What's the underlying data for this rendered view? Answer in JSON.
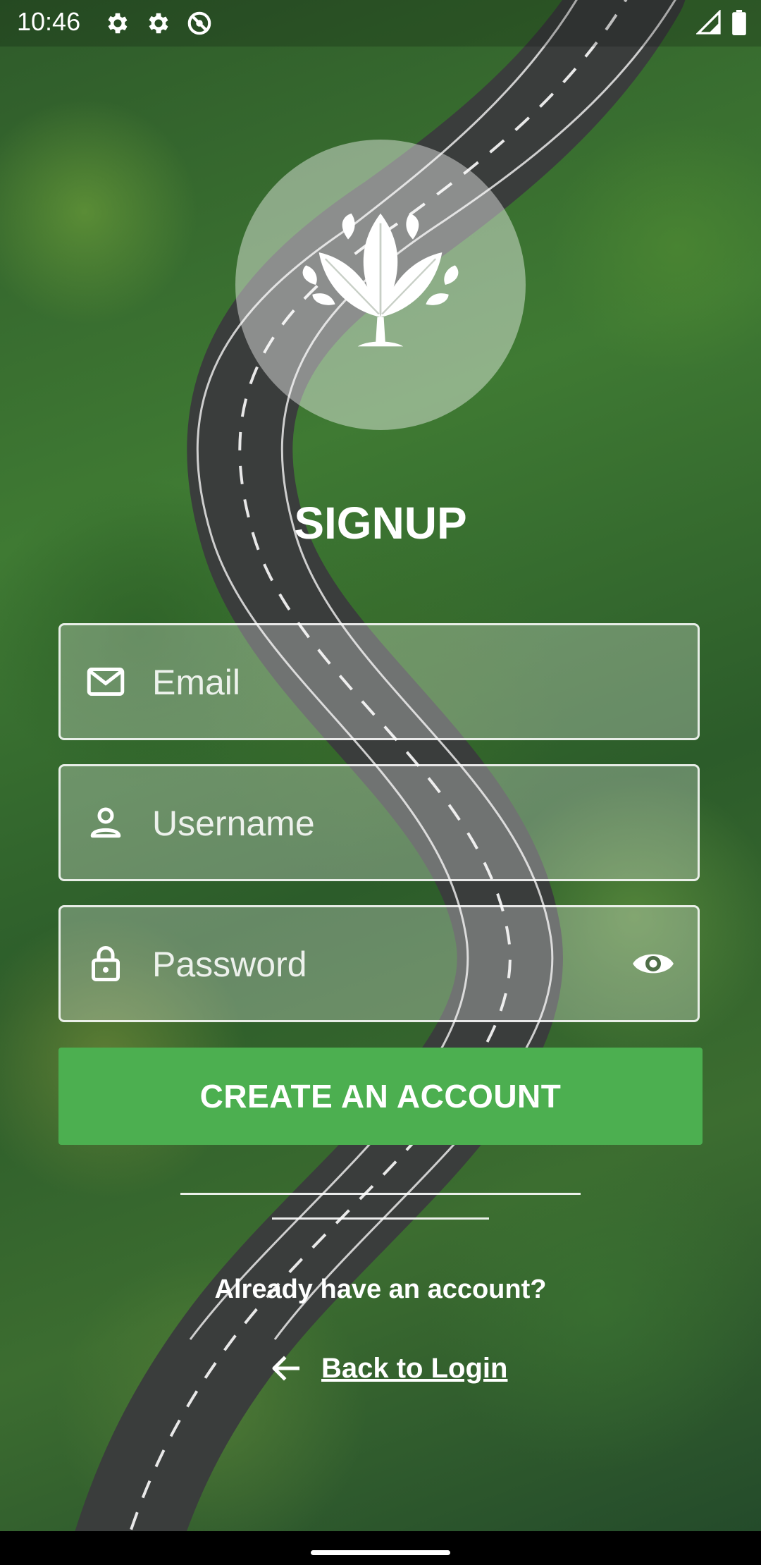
{
  "status_bar": {
    "time": "10:46",
    "left_icons": [
      "settings-gear-icon",
      "settings-gear-icon",
      "do-not-disturb-icon"
    ],
    "right_icons": [
      "cellular-signal-icon",
      "battery-icon"
    ]
  },
  "logo": {
    "icon": "lotus-leaf-icon"
  },
  "title": "SIGNUP",
  "form": {
    "email_placeholder": "Email",
    "email_icon": "mail-icon",
    "username_placeholder": "Username",
    "username_icon": "person-icon",
    "password_placeholder": "Password",
    "password_icon": "lock-icon",
    "password_toggle_icon": "eye-icon",
    "submit_label": "CREATE AN ACCOUNT"
  },
  "footer": {
    "prompt": "Already have an account?",
    "back_label": "Back to Login",
    "back_icon": "arrow-left-icon"
  },
  "colors": {
    "accent": "#4caf50",
    "text": "#ffffff"
  }
}
